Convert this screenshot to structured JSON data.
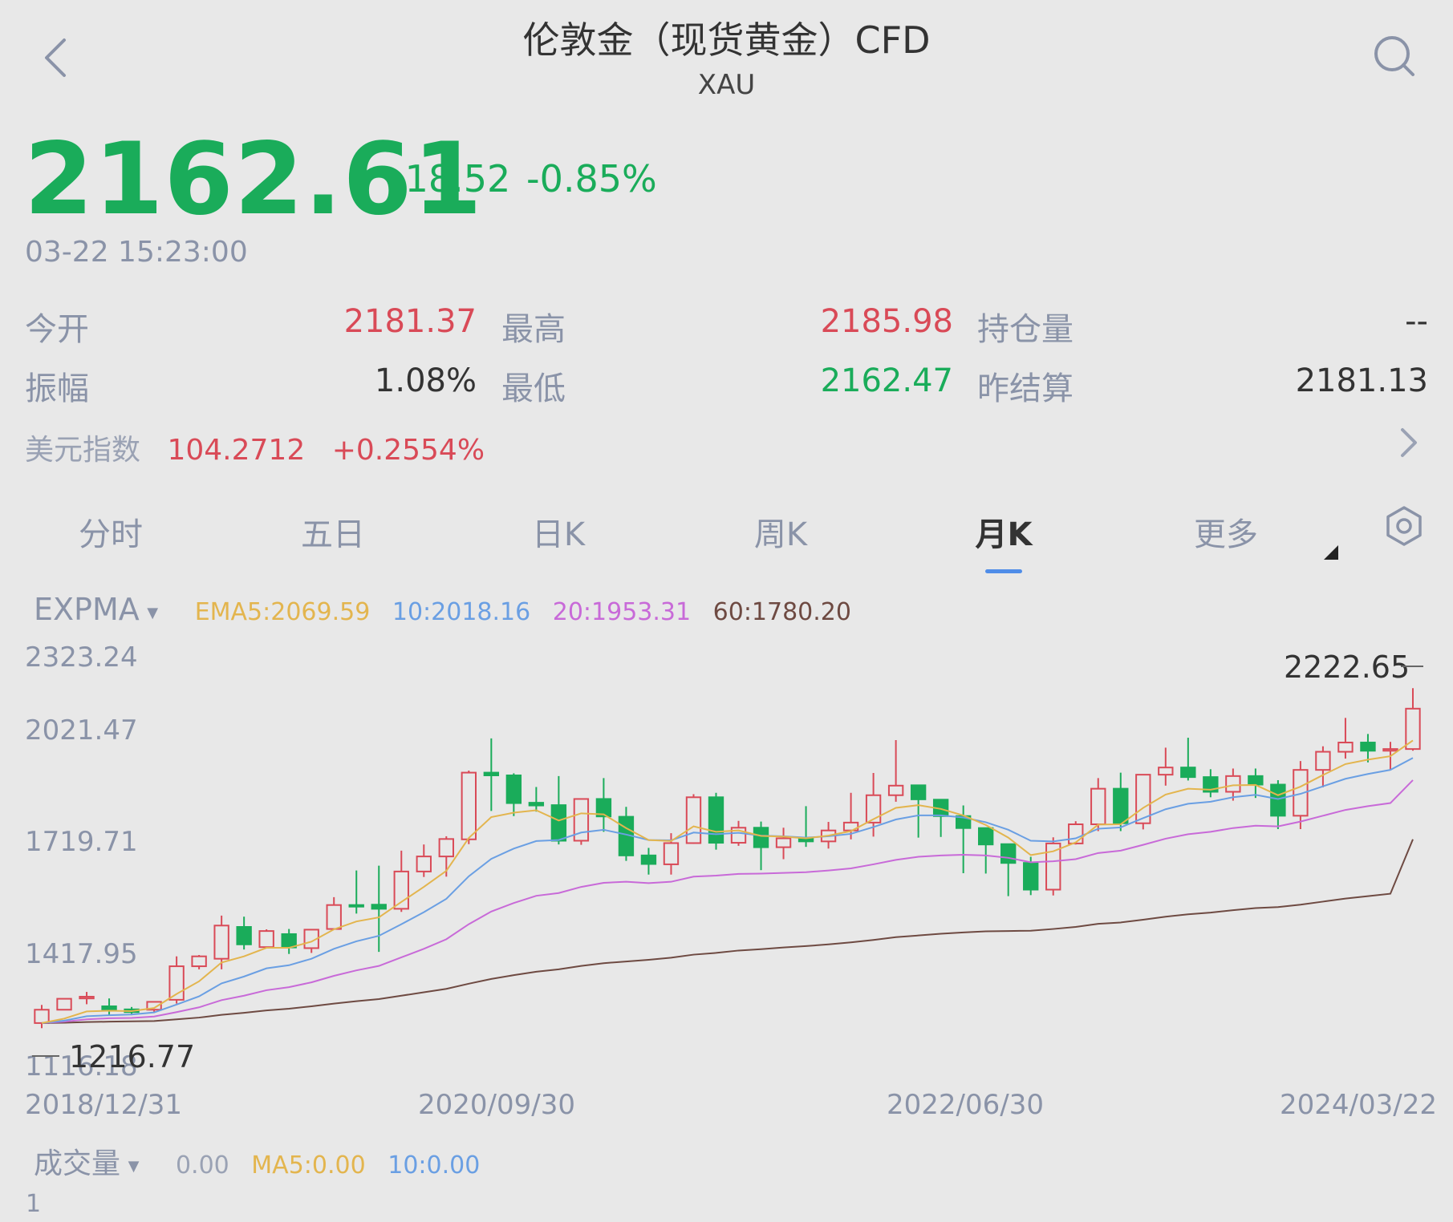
{
  "header": {
    "title": "伦敦金（现货黄金）CFD",
    "subtitle": "XAU",
    "back_icon": "chevron-left-icon",
    "search_icon": "search-icon"
  },
  "quote": {
    "price": "2162.61",
    "change": "-18.52",
    "change_pct": "-0.85%",
    "timestamp": "03-22 15:23:00",
    "open_label": "今开",
    "open_value": "2181.37",
    "high_label": "最高",
    "high_value": "2185.98",
    "oi_label": "持仓量",
    "oi_value": "--",
    "amplitude_label": "振幅",
    "amplitude_value": "1.08%",
    "low_label": "最低",
    "low_value": "2162.47",
    "prev_settle_label": "昨结算",
    "prev_settle_value": "2181.13"
  },
  "usd_index": {
    "label": "美元指数",
    "value": "104.2712",
    "change_pct": "+0.2554%"
  },
  "tabs": [
    {
      "label": "分时",
      "active": false
    },
    {
      "label": "五日",
      "active": false
    },
    {
      "label": "日K",
      "active": false
    },
    {
      "label": "周K",
      "active": false
    },
    {
      "label": "月K",
      "active": true
    },
    {
      "label": "更多",
      "active": false
    }
  ],
  "indicator": {
    "name": "EXPMA",
    "ema5": "EMA5:2069.59",
    "ema10": "10:2018.16",
    "ema20": "20:1953.31",
    "ema60": "60:1780.20"
  },
  "volume": {
    "name": "成交量",
    "value": "0.00",
    "ma5": "MA5:0.00",
    "ma10": "10:0.00",
    "axis_max": "1"
  },
  "colors": {
    "up": "#d94a57",
    "down": "#1aac5a",
    "ema5": "#e3b54e",
    "ema10": "#6a9fe3",
    "ema20": "#c86ad8",
    "ema60": "#6e4a42",
    "accent": "#4f8de8"
  },
  "chart_data": {
    "type": "candlestick",
    "period": "monthly",
    "y_ticks": [
      "2323.24",
      "2021.47",
      "1719.71",
      "1417.95",
      "1116.18"
    ],
    "x_ticks": [
      "2018/12/31",
      "2020/09/30",
      "2022/06/30",
      "2024/03/22"
    ],
    "max_label": "2222.65",
    "min_label": "1216.77",
    "ylim": [
      1116.18,
      2323.24
    ],
    "candles": [
      {
        "o": 1243,
        "h": 1296,
        "l": 1228,
        "c": 1282
      },
      {
        "o": 1282,
        "h": 1302,
        "l": 1283,
        "c": 1314
      },
      {
        "o": 1315,
        "h": 1334,
        "l": 1298,
        "c": 1320
      },
      {
        "o": 1292,
        "h": 1315,
        "l": 1266,
        "c": 1283
      },
      {
        "o": 1283,
        "h": 1290,
        "l": 1266,
        "c": 1275
      },
      {
        "o": 1282,
        "h": 1305,
        "l": 1275,
        "c": 1305
      },
      {
        "o": 1311,
        "h": 1438,
        "l": 1300,
        "c": 1409
      },
      {
        "o": 1409,
        "h": 1442,
        "l": 1400,
        "c": 1438
      },
      {
        "o": 1431,
        "h": 1557,
        "l": 1400,
        "c": 1528
      },
      {
        "o": 1524,
        "h": 1554,
        "l": 1458,
        "c": 1473
      },
      {
        "o": 1465,
        "h": 1517,
        "l": 1461,
        "c": 1512
      },
      {
        "o": 1503,
        "h": 1518,
        "l": 1445,
        "c": 1464
      },
      {
        "o": 1462,
        "h": 1516,
        "l": 1448,
        "c": 1516
      },
      {
        "o": 1518,
        "h": 1611,
        "l": 1517,
        "c": 1588
      },
      {
        "o": 1588,
        "h": 1689,
        "l": 1563,
        "c": 1585
      },
      {
        "o": 1589,
        "h": 1703,
        "l": 1451,
        "c": 1577
      },
      {
        "o": 1577,
        "h": 1747,
        "l": 1568,
        "c": 1686
      },
      {
        "o": 1686,
        "h": 1765,
        "l": 1670,
        "c": 1730
      },
      {
        "o": 1730,
        "h": 1789,
        "l": 1671,
        "c": 1781
      },
      {
        "o": 1780,
        "h": 1981,
        "l": 1766,
        "c": 1975
      },
      {
        "o": 1975,
        "h": 2075,
        "l": 1863,
        "c": 1967
      },
      {
        "o": 1967,
        "h": 1973,
        "l": 1848,
        "c": 1886
      },
      {
        "o": 1887,
        "h": 1933,
        "l": 1861,
        "c": 1879
      },
      {
        "o": 1880,
        "h": 1965,
        "l": 1765,
        "c": 1776
      },
      {
        "o": 1776,
        "h": 1875,
        "l": 1764,
        "c": 1898
      },
      {
        "o": 1898,
        "h": 1959,
        "l": 1802,
        "c": 1847
      },
      {
        "o": 1846,
        "h": 1875,
        "l": 1717,
        "c": 1733
      },
      {
        "o": 1733,
        "h": 1755,
        "l": 1677,
        "c": 1708
      },
      {
        "o": 1707,
        "h": 1798,
        "l": 1677,
        "c": 1769
      },
      {
        "o": 1769,
        "h": 1912,
        "l": 1767,
        "c": 1903
      },
      {
        "o": 1903,
        "h": 1916,
        "l": 1750,
        "c": 1770
      },
      {
        "o": 1770,
        "h": 1834,
        "l": 1761,
        "c": 1814
      },
      {
        "o": 1814,
        "h": 1832,
        "l": 1690,
        "c": 1757
      },
      {
        "o": 1757,
        "h": 1814,
        "l": 1722,
        "c": 1783
      },
      {
        "o": 1783,
        "h": 1877,
        "l": 1758,
        "c": 1774
      },
      {
        "o": 1774,
        "h": 1831,
        "l": 1753,
        "c": 1806
      },
      {
        "o": 1806,
        "h": 1916,
        "l": 1780,
        "c": 1829
      },
      {
        "o": 1829,
        "h": 1974,
        "l": 1788,
        "c": 1909
      },
      {
        "o": 1909,
        "h": 2070,
        "l": 1890,
        "c": 1937
      },
      {
        "o": 1938,
        "h": 1910,
        "l": 1785,
        "c": 1897
      },
      {
        "o": 1896,
        "h": 1870,
        "l": 1787,
        "c": 1848
      },
      {
        "o": 1848,
        "h": 1879,
        "l": 1681,
        "c": 1813
      },
      {
        "o": 1813,
        "h": 1807,
        "l": 1680,
        "c": 1765
      },
      {
        "o": 1766,
        "h": 1765,
        "l": 1614,
        "c": 1711
      },
      {
        "o": 1711,
        "h": 1729,
        "l": 1617,
        "c": 1633
      },
      {
        "o": 1633,
        "h": 1786,
        "l": 1616,
        "c": 1768
      },
      {
        "o": 1768,
        "h": 1833,
        "l": 1765,
        "c": 1824
      },
      {
        "o": 1824,
        "h": 1959,
        "l": 1804,
        "c": 1928
      },
      {
        "o": 1928,
        "h": 1975,
        "l": 1804,
        "c": 1827
      },
      {
        "o": 1827,
        "h": 1937,
        "l": 1809,
        "c": 1969
      },
      {
        "o": 1969,
        "h": 2048,
        "l": 1937,
        "c": 1990
      },
      {
        "o": 1990,
        "h": 2077,
        "l": 1952,
        "c": 1962
      },
      {
        "o": 1962,
        "h": 1985,
        "l": 1903,
        "c": 1919
      },
      {
        "o": 1919,
        "h": 1987,
        "l": 1893,
        "c": 1965
      },
      {
        "o": 1965,
        "h": 1987,
        "l": 1901,
        "c": 1940
      },
      {
        "o": 1940,
        "h": 1953,
        "l": 1810,
        "c": 1849
      },
      {
        "o": 1849,
        "h": 2009,
        "l": 1810,
        "c": 1983
      },
      {
        "o": 1983,
        "h": 2052,
        "l": 1932,
        "c": 2036
      },
      {
        "o": 2036,
        "h": 2135,
        "l": 2016,
        "c": 2063
      },
      {
        "o": 2063,
        "h": 2088,
        "l": 2005,
        "c": 2039
      },
      {
        "o": 2039,
        "h": 2065,
        "l": 1984,
        "c": 2044
      },
      {
        "o": 2044,
        "h": 2222,
        "l": 2039,
        "c": 2162
      }
    ],
    "ema5": [
      1243,
      1256,
      1277,
      1279,
      1278,
      1287,
      1328,
      1365,
      1420,
      1438,
      1463,
      1463,
      1481,
      1517,
      1540,
      1552,
      1597,
      1641,
      1688,
      1784,
      1845,
      1858,
      1865,
      1835,
      1856,
      1853,
      1813,
      1778,
      1775,
      1818,
      1802,
      1806,
      1790,
      1788,
      1783,
      1791,
      1804,
      1839,
      1872,
      1880,
      1869,
      1850,
      1822,
      1785,
      1734,
      1745,
      1771,
      1823,
      1824,
      1872,
      1911,
      1928,
      1925,
      1938,
      1939,
      1909,
      1934,
      1968,
      2000,
      2013,
      2023,
      2069
    ],
    "ema10": [
      1243,
      1250,
      1263,
      1266,
      1268,
      1274,
      1297,
      1321,
      1359,
      1379,
      1403,
      1412,
      1431,
      1460,
      1482,
      1498,
      1532,
      1567,
      1606,
      1672,
      1723,
      1753,
      1775,
      1778,
      1800,
      1808,
      1794,
      1778,
      1777,
      1800,
      1795,
      1799,
      1791,
      1789,
      1785,
      1789,
      1796,
      1816,
      1838,
      1850,
      1850,
      1844,
      1830,
      1808,
      1776,
      1774,
      1783,
      1811,
      1815,
      1842,
      1868,
      1884,
      1890,
      1903,
      1910,
      1898,
      1913,
      1935,
      1957,
      1971,
      1983,
      2018
    ],
    "ema20": [
      1243,
      1247,
      1254,
      1257,
      1258,
      1262,
      1275,
      1289,
      1310,
      1323,
      1339,
      1348,
      1362,
      1381,
      1397,
      1410,
      1435,
      1460,
      1488,
      1532,
      1569,
      1594,
      1615,
      1623,
      1641,
      1653,
      1656,
      1652,
      1656,
      1671,
      1674,
      1679,
      1680,
      1682,
      1684,
      1689,
      1695,
      1707,
      1720,
      1729,
      1733,
      1735,
      1733,
      1726,
      1713,
      1716,
      1722,
      1740,
      1747,
      1764,
      1782,
      1795,
      1802,
      1813,
      1820,
      1818,
      1832,
      1849,
      1866,
      1877,
      1886,
      1953
    ],
    "ema60": [
      1243,
      1244,
      1246,
      1247,
      1248,
      1249,
      1254,
      1259,
      1267,
      1273,
      1280,
      1285,
      1292,
      1300,
      1307,
      1313,
      1323,
      1333,
      1343,
      1358,
      1372,
      1383,
      1393,
      1400,
      1410,
      1418,
      1423,
      1428,
      1434,
      1443,
      1448,
      1455,
      1459,
      1464,
      1468,
      1473,
      1479,
      1486,
      1494,
      1499,
      1504,
      1508,
      1511,
      1512,
      1513,
      1518,
      1524,
      1533,
      1537,
      1545,
      1554,
      1561,
      1566,
      1573,
      1579,
      1582,
      1589,
      1598,
      1607,
      1614,
      1621,
      1780
    ]
  }
}
